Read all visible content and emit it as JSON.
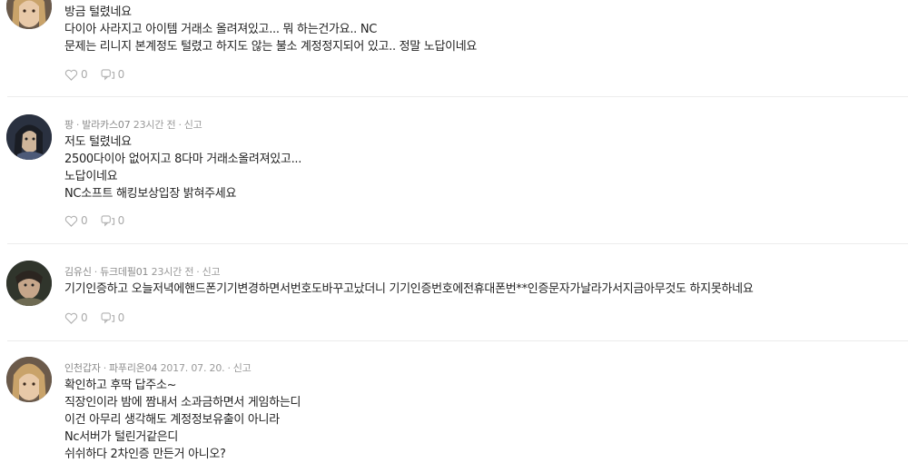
{
  "comments": [
    {
      "author": "",
      "server": "",
      "time": "",
      "report_label": "",
      "lines": [
        "방금 털렸네요",
        "다이아 사라지고 아이템 거래소 올려져있고... 뭐 하는건가요.. NC",
        "문제는 리니지 본계정도 털렸고 하지도 않는 불소 계정정지되어 있고.. 정말 노답이네요"
      ],
      "likes": "0",
      "replies": "0"
    },
    {
      "author": "팡",
      "server": "발라카스07",
      "time": "23시간 전",
      "report_label": "신고",
      "lines": [
        "저도 털렸네요",
        "2500다이아 없어지고 8다마 거래소올려져있고...",
        "노답이네요",
        "NC소프트 해킹보상입장 밝혀주세요"
      ],
      "likes": "0",
      "replies": "0"
    },
    {
      "author": "김유신",
      "server": "듀크데필01",
      "time": "23시간 전",
      "report_label": "신고",
      "lines": [
        "기기인증하고 오늘저녁에핸드폰기기변경하면서번호도바꾸고났더니 기기인증번호에전휴대폰번**인증문자가날라가서지금아무것도 하지못하네요"
      ],
      "likes": "0",
      "replies": "0"
    },
    {
      "author": "인천갑자",
      "server": "파푸리온04",
      "time": "2017. 07. 20.",
      "report_label": "신고",
      "lines": [
        "확인하고 후딱 답주소~",
        "직장인이라 밤에 짬내서 소과금하면서 게임하는디",
        "이건 아무리 생각해도 계정정보유출이 아니라",
        "Nc서버가 털린거같은디",
        "쉬쉬하다 2차인증 만든거 아니오?"
      ],
      "likes": "",
      "replies": ""
    }
  ]
}
